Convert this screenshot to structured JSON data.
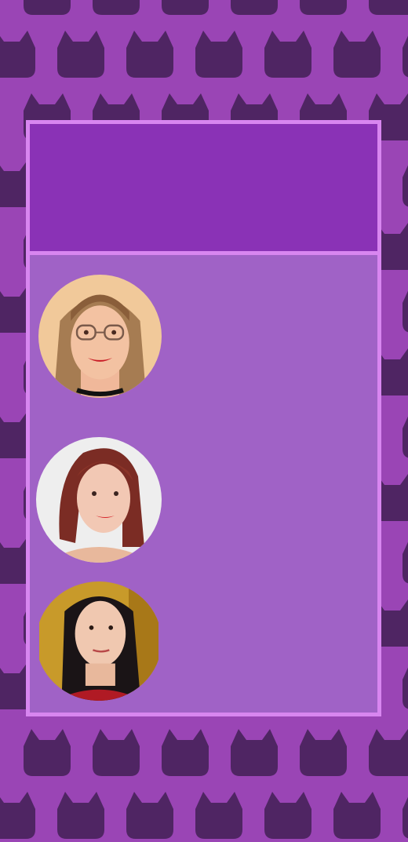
{
  "theme": {
    "background": "#9a45b5",
    "pattern": "#4f2563",
    "panel_border": "#d886f0",
    "panel_header": "#8a32b6",
    "panel_body": "#a062c6"
  },
  "background_pattern_icon": "cat-head-icon",
  "header": {},
  "users": [
    {
      "avatar_icon": "user-avatar-1"
    },
    {
      "avatar_icon": "user-avatar-2"
    },
    {
      "avatar_icon": "user-avatar-3"
    }
  ]
}
